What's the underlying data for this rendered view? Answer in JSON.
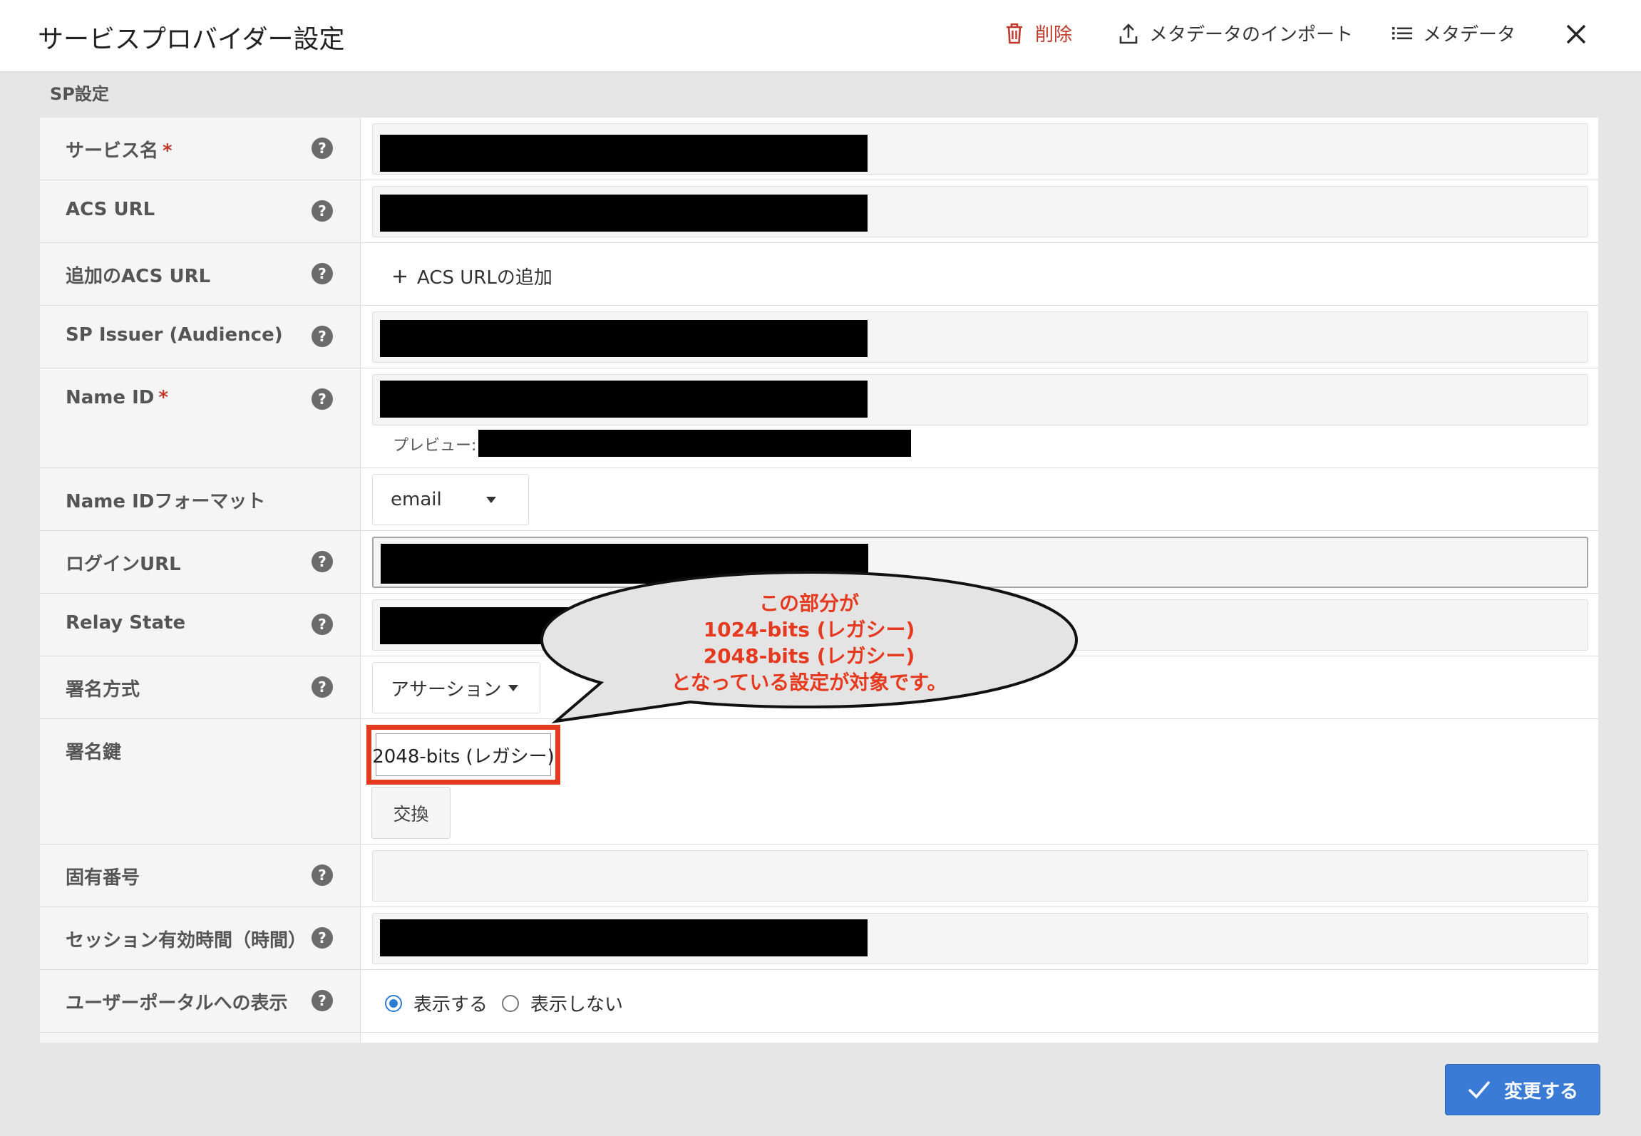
{
  "header": {
    "title": "サービスプロバイダー設定",
    "delete_label": "削除",
    "import_label": "メタデータのインポート",
    "metadata_label": "メタデータ"
  },
  "section": {
    "label": "SP設定"
  },
  "fields": {
    "service_name": {
      "label": "サービス名",
      "required": "*"
    },
    "acs_url": {
      "label": "ACS URL"
    },
    "additional_acs": {
      "label": "追加のACS URL",
      "add_label": "ACS URLの追加"
    },
    "sp_issuer": {
      "label": "SP Issuer (Audience)"
    },
    "name_id": {
      "label": "Name ID",
      "required": "*",
      "preview_label": "プレビュー:"
    },
    "name_id_format": {
      "label": "Name IDフォーマット",
      "value": "email"
    },
    "login_url": {
      "label": "ログインURL"
    },
    "relay_state": {
      "label": "Relay State"
    },
    "signature_method": {
      "label": "署名方式",
      "value": "アサーション"
    },
    "signing_key": {
      "label": "署名鍵",
      "value": "2048-bits (レガシー)",
      "exchange_label": "交換"
    },
    "unique_number": {
      "label": "固有番号"
    },
    "session_duration": {
      "label": "セッション有効時間（時間）"
    },
    "portal_display": {
      "label": "ユーザーポータルへの表示",
      "option_show": "表示する",
      "option_hide": "表示しない",
      "selected": "表示する"
    }
  },
  "callout": {
    "line1": "この部分が",
    "line2": "1024-bits (レガシー)",
    "line3": "2048-bits (レガシー)",
    "line4": "となっている設定が対象です。"
  },
  "footer": {
    "save_label": "変更する"
  },
  "colors": {
    "accent": "#3a7bd5",
    "danger": "#c0392b",
    "annotation": "#e53a1f"
  }
}
